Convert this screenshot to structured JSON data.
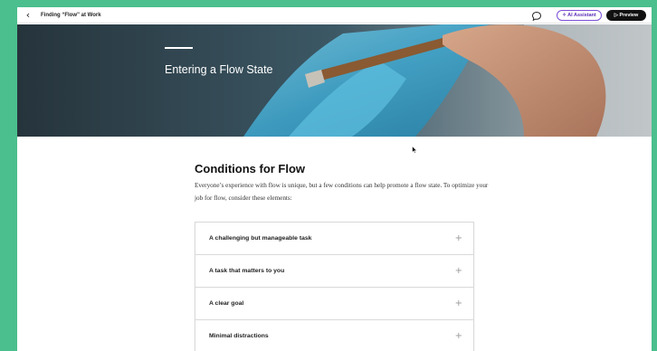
{
  "topbar": {
    "back_icon": "chevron-left-icon",
    "back_glyph": "‹",
    "course_title": "Finding “Flow” at Work",
    "comment_icon": "comment-icon",
    "ai_label": "✧ AI Assistant",
    "preview_label": "▷ Preview"
  },
  "hero": {
    "title": "Entering a Flow State"
  },
  "section": {
    "heading": "Conditions for Flow",
    "body": "Everyone’s experience with flow is unique, but a few conditions can help promote a flow state. To optimize your job for flow, consider these elements:"
  },
  "accordion": {
    "items": [
      {
        "label": "A challenging but manageable task"
      },
      {
        "label": "A task that matters to you"
      },
      {
        "label": "A clear goal"
      },
      {
        "label": "Minimal distractions"
      }
    ],
    "expand_glyph": "+"
  },
  "colors": {
    "outer_background": "#4bbf8e",
    "ai_accent": "#7a4fd6",
    "preview_bg": "#111111"
  }
}
